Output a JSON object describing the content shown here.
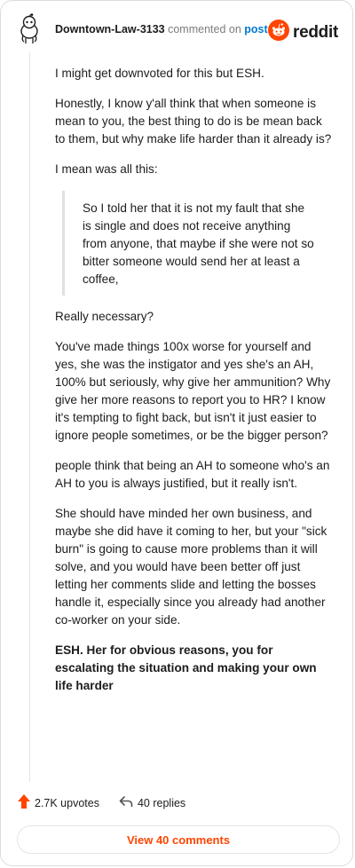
{
  "header": {
    "username": "Downtown-Law-3133",
    "verb": "commented on",
    "post_link": "post",
    "brand": "reddit"
  },
  "comment": {
    "paragraphs_top": [
      "I might get downvoted for this but ESH.",
      "Honestly, I know y'all think that when someone is mean to you, the best thing to do is be mean back to them, but why make life harder than it already is?",
      "I mean was all this:"
    ],
    "quote": "So I told her that it is not my fault that she is single and does not receive anything from anyone, that maybe if she were not so bitter someone would send her at least a coffee,",
    "paragraphs_bottom": [
      "Really necessary?",
      "You've made things 100x worse for yourself and yes, she was the instigator and yes she's an AH, 100% but seriously, why give her ammunition? Why give her more reasons to report you to HR? I know it's tempting to fight back, but isn't it just easier to ignore people sometimes, or be the bigger person?",
      "people think that being an AH to someone who's an AH to you is always justified, but it really isn't.",
      "She should have minded her own business, and maybe she did have it coming to her, but your \"sick burn\" is going to cause more problems than it will solve, and you would have been better off just letting her comments slide and letting the bosses handle it, especially since you already had another co-worker on your side."
    ],
    "conclusion": "ESH. Her for obvious reasons, you for escalating the situation and making your own life harder"
  },
  "footer": {
    "upvotes": "2.7K upvotes",
    "replies": "40 replies",
    "view_comments": "View 40 comments"
  },
  "colors": {
    "accent": "#ff4500",
    "link": "#0079d3",
    "muted": "#7c7c7c"
  },
  "icons": {
    "avatar": "snoo-avatar-icon",
    "brand": "reddit-logo-icon",
    "upvote": "upvote-arrow-icon",
    "reply": "reply-arrow-icon"
  }
}
